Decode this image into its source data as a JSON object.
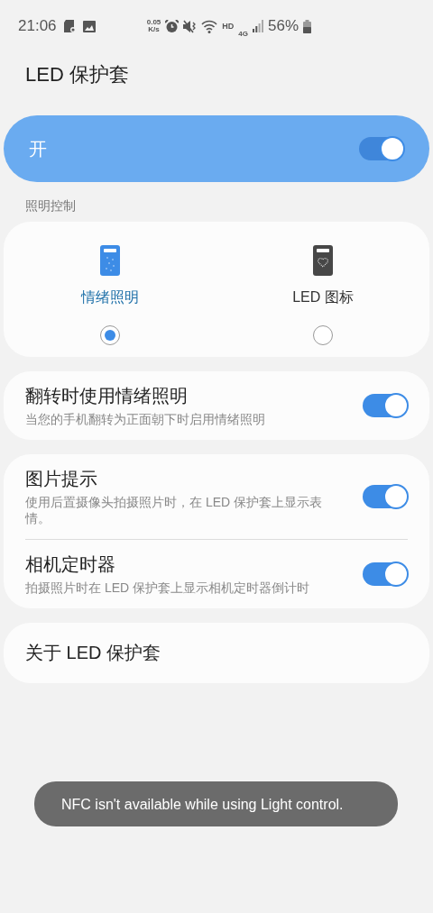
{
  "status_bar": {
    "time": "21:06",
    "speed_value": "0.05",
    "speed_unit": "K/s",
    "hd": "HD",
    "network": "4G",
    "battery": "56%"
  },
  "title": "LED 保护套",
  "master": {
    "label": "开",
    "on": true
  },
  "section": "照明控制",
  "lighting_options": [
    {
      "label": "情绪照明",
      "kind": "mood",
      "selected": true
    },
    {
      "label": "LED 图标",
      "kind": "icon",
      "selected": false
    }
  ],
  "cards": [
    {
      "items": [
        {
          "title": "翻转时使用情绪照明",
          "subtitle": "当您的手机翻转为正面朝下时启用情绪照明",
          "on": true
        }
      ]
    },
    {
      "items": [
        {
          "title": "图片提示",
          "subtitle": "使用后置摄像头拍摄照片时，在 LED 保护套上显示表情。",
          "on": true
        },
        {
          "title": "相机定时器",
          "subtitle": "拍摄照片时在 LED 保护套上显示相机定时器倒计时",
          "on": true
        }
      ]
    },
    {
      "items": [
        {
          "title": "关于 LED 保护套"
        }
      ]
    }
  ],
  "toast": "NFC isn't available while using Light control."
}
